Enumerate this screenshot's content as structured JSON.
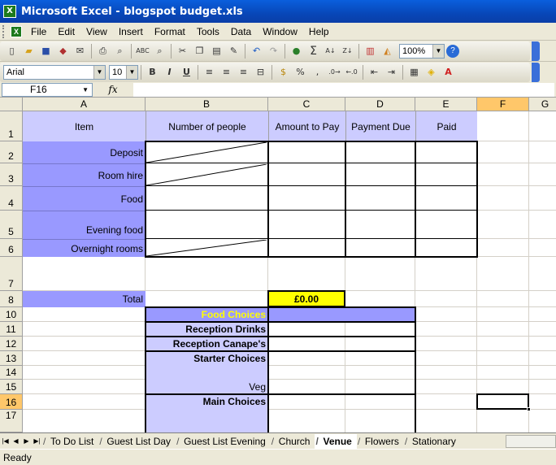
{
  "window": {
    "title": "Microsoft Excel - blogspot budget.xls"
  },
  "menu": [
    "File",
    "Edit",
    "View",
    "Insert",
    "Format",
    "Tools",
    "Data",
    "Window",
    "Help"
  ],
  "toolbar": {
    "zoom": "100%",
    "font": "Arial",
    "size": "10",
    "bold": "B",
    "italic": "I",
    "underline": "U",
    "currency": "%",
    "comma": ",",
    "sum": "Σ"
  },
  "formula_bar": {
    "name_box": "F16",
    "fx": "fx",
    "content": ""
  },
  "columns": [
    "A",
    "B",
    "C",
    "D",
    "E",
    "F",
    "G"
  ],
  "rows": [
    "1",
    "2",
    "3",
    "4",
    "5",
    "6",
    "7",
    "8",
    "10",
    "11",
    "12",
    "13",
    "14",
    "15",
    "16",
    "17"
  ],
  "cells": {
    "header_item": "Item",
    "header_people": "Number of people",
    "header_amount": "Amount to Pay",
    "header_due": "Payment Due",
    "header_paid": "Paid",
    "deposit": "Deposit",
    "room_hire": "Room hire",
    "food": "Food",
    "evening_food": "Evening food",
    "overnight_rooms": "Overnight rooms",
    "total_label": "Total",
    "total_value": "£0.00",
    "food_choices": "Food Choices",
    "reception_drinks": "Reception Drinks",
    "reception_canapes": "Reception Canape's",
    "starter_choices": "Starter Choices",
    "veg": "Veg",
    "main_choices": "Main Choices"
  },
  "sheet_tabs": [
    "To Do List",
    "Guest List Day",
    "Guest List Evening",
    "Church",
    "Venue",
    "Flowers",
    "Stationary"
  ],
  "active_tab": "Venue",
  "status": "Ready",
  "colors": {
    "item_fill": "#9999ff",
    "header_fill": "#ccccff",
    "total_fill": "#ffff00",
    "food_choices_text": "#ffff00",
    "selected_header": "#ffc76a"
  }
}
